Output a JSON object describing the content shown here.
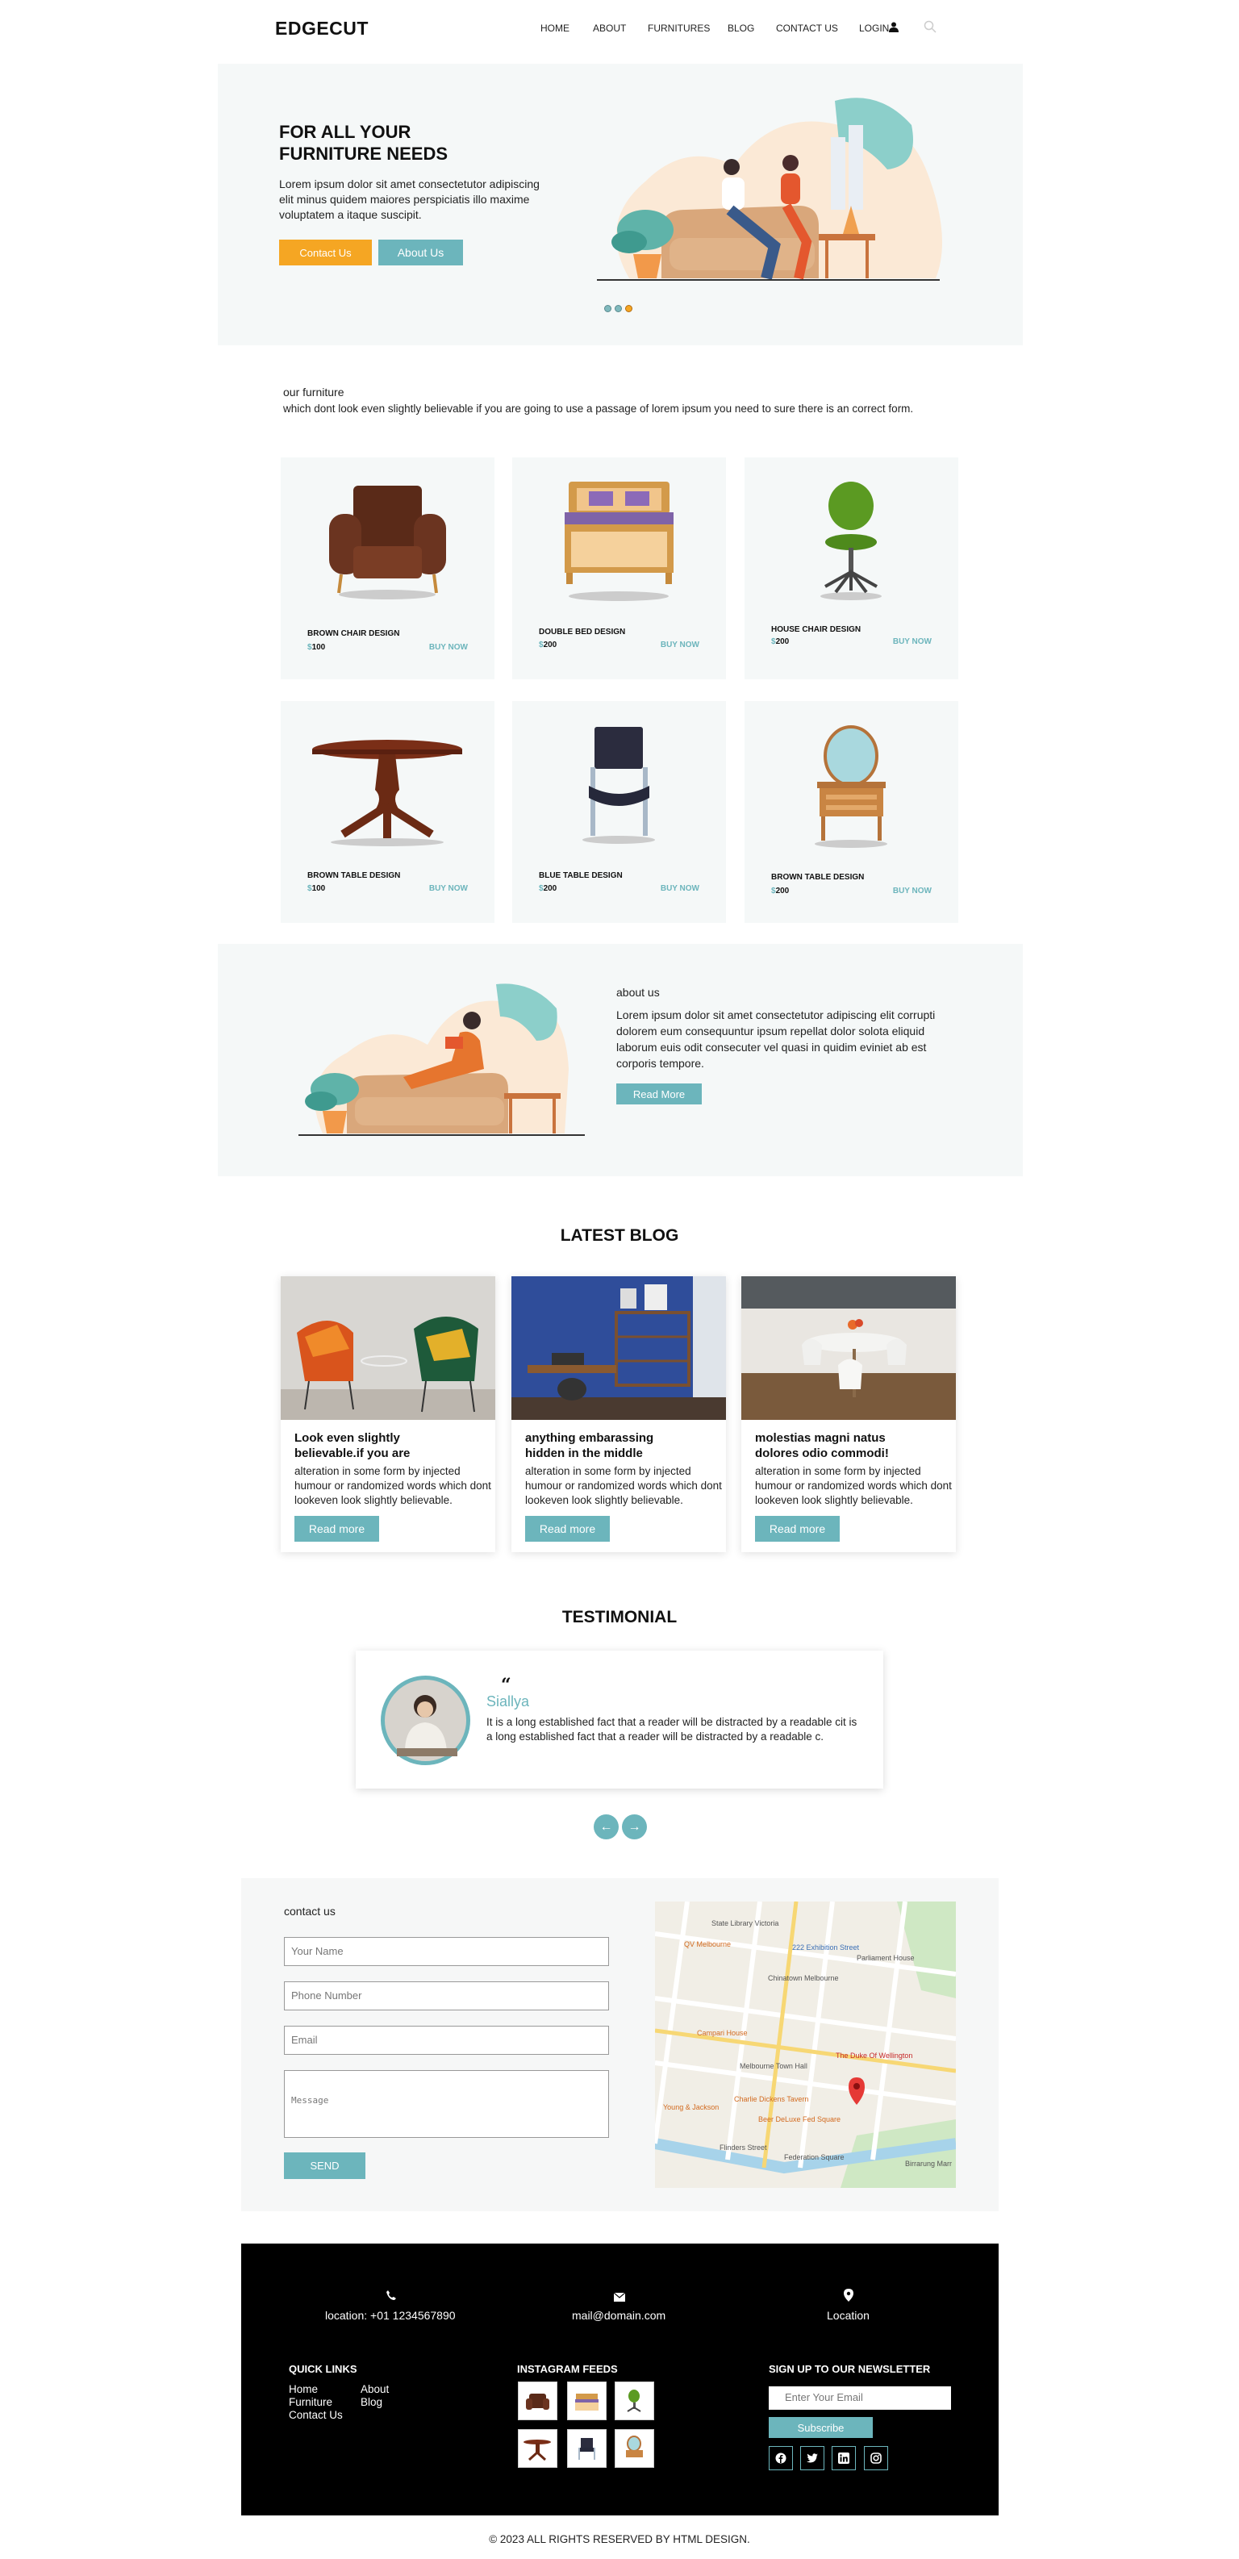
{
  "header": {
    "logo": "EDGECUT",
    "nav": [
      "HOME",
      "ABOUT",
      "FURNITURES",
      "BLOG",
      "CONTACT US"
    ],
    "login": "LOGIN",
    "icons": {
      "user": "user-icon",
      "search": "search-icon"
    }
  },
  "hero": {
    "title_line1": "FOR ALL YOUR",
    "title_line2": "FURNITURE NEEDS",
    "text": "Lorem ipsum dolor sit amet consectetutor adipiscing elit minus quidem maiores perspiciatis illo maxime voluptatem a itaque suscipit.",
    "contact_btn": "Contact Us",
    "about_btn": "About Us",
    "slide_count": 3,
    "active_slide": 3
  },
  "furniture": {
    "heading": "our furniture",
    "subheading": "which dont look even slightly believable if you are going to use a passage of lorem ipsum you need to sure there is an correct form.",
    "currency": "$",
    "buy_label": "BUY NOW",
    "items": [
      {
        "name": "BROWN CHAIR DESIGN",
        "price": "100"
      },
      {
        "name": "DOUBLE BED DESIGN",
        "price": "200"
      },
      {
        "name": "HOUSE CHAIR DESIGN",
        "price": "200"
      },
      {
        "name": "BROWN TABLE DESIGN",
        "price": "100"
      },
      {
        "name": "BLUE TABLE DESIGN",
        "price": "200"
      },
      {
        "name": "BROWN TABLE DESIGN",
        "price": "200"
      }
    ]
  },
  "about": {
    "heading": "about us",
    "text": "Lorem ipsum dolor sit amet consectetutor adipiscing elit corrupti dolorem eum consequuntur ipsum repellat dolor solota eliquid laborum euis odit consecuter vel quasi in quidim eviniet ab est corporis tempore.",
    "button": "Read More"
  },
  "blog": {
    "heading": "LATEST BLOG",
    "read_more": "Read more",
    "posts": [
      {
        "title_line1": "Look even slightly",
        "title_line2": "believable.if you are",
        "text": "alteration in some form by injected humour or randomized words which dont lookeven look slightly believable."
      },
      {
        "title_line1": "anything embarassing",
        "title_line2": "hidden in the middle",
        "text": "alteration in some form by injected humour or randomized words which dont lookeven look slightly believable."
      },
      {
        "title_line1": "molestias magni natus",
        "title_line2": "dolores odio commodi!",
        "text": "alteration in some form by injected humour or randomized words which dont lookeven look slightly believable."
      }
    ]
  },
  "testimonial": {
    "heading": "TESTIMONIAL",
    "quote_mark": "“",
    "name": "Siallya",
    "text": "It is a long established fact that a reader will be distracted by a readable cit is a long established fact that a reader will be distracted by a readable c.",
    "prev": "←",
    "next": "→"
  },
  "contact": {
    "heading": "contact us",
    "name_placeholder": "Your Name",
    "phone_placeholder": "Phone Number",
    "email_placeholder": "Email",
    "message_placeholder": "Message",
    "send": "SEND",
    "map_labels": [
      "State Library Victoria",
      "QV Melbourne",
      "222 Exhibition Street",
      "Parliament House",
      "Chinatown Melbourne",
      "Campari House",
      "Melbourne Town Hall",
      "The Duke Of Wellington",
      "Charlie Dickens Tavern",
      "Beer DeLuxe Fed Square",
      "Federation Square",
      "Young & Jackson",
      "Flinders Street",
      "Birrarung Marr"
    ]
  },
  "footer": {
    "phone": "location: +01 1234567890",
    "email": "mail@domain.com",
    "location": "Location",
    "quick_links_title": "QUICK LINKS",
    "links_col1": [
      "Home",
      "Furniture",
      "Contact Us"
    ],
    "links_col2": [
      "About",
      "Blog"
    ],
    "insta_title": "INSTAGRAM FEEDS",
    "newsletter_title": "SIGN UP TO OUR NEWSLETTER",
    "newsletter_placeholder": "Enter Your Email",
    "subscribe": "Subscribe",
    "socials": [
      "facebook-icon",
      "twitter-icon",
      "linkedin-icon",
      "instagram-icon"
    ],
    "copyright": "© 2023 ALL RIGHTS RESERVED BY HTML DESIGN."
  },
  "colors": {
    "accent": "#6cb5bc",
    "orange": "#f5a623",
    "panel": "#f5f8f8",
    "footer": "#000000"
  }
}
